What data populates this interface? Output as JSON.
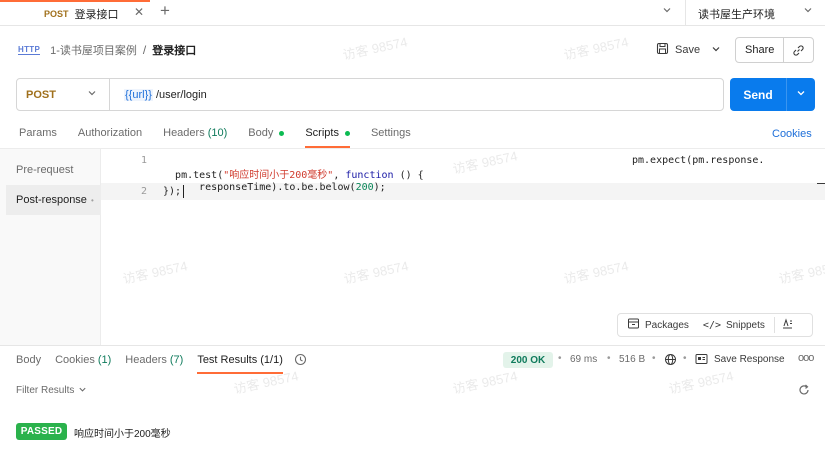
{
  "tab": {
    "method": "POST",
    "title": "登录接口",
    "close": "✕",
    "add": "+"
  },
  "environment": {
    "name": "读书屋生产环境"
  },
  "breadcrumb": {
    "protocol_icon_text": "HTTP",
    "collection": "1-读书屋项目案例",
    "separator": "/",
    "request": "登录接口"
  },
  "actions": {
    "save_label": "Save",
    "share_label": "Share"
  },
  "request": {
    "method": "POST",
    "url_variable": "{{url}}",
    "url_path": " /user/login",
    "send_label": "Send"
  },
  "request_tabs": [
    {
      "label": "Params"
    },
    {
      "label": "Authorization"
    },
    {
      "label": "Headers",
      "count": "(10)"
    },
    {
      "label": "Body",
      "dot": true
    },
    {
      "label": "Scripts",
      "dot": true,
      "active": true
    },
    {
      "label": "Settings"
    }
  ],
  "cookies_link": "Cookies",
  "scripts_side": {
    "pre_request": "Pre-request",
    "post_response": "Post-response",
    "post_response_dot": "•"
  },
  "editor": {
    "line_numbers": [
      "1",
      "2"
    ],
    "line1_a": "pm.test(",
    "line1_str": "\"响应时间小于200毫秒\"",
    "line1_b": ", ",
    "line1_kw": "function",
    "line1_c": " () {",
    "line1_right": "pm.expect(pm.response.",
    "line1_wrap_a": "responseTime).to.be.below(",
    "line1_wrap_num": "200",
    "line1_wrap_b": ");",
    "line2": "});"
  },
  "editor_tools": {
    "packages": "Packages",
    "snippets_glyph": "</>",
    "snippets": "Snippets"
  },
  "response_tabs": [
    {
      "label": "Body"
    },
    {
      "label": "Cookies",
      "count": "(1)"
    },
    {
      "label": "Headers",
      "count": "(7)"
    },
    {
      "label": "Test Results",
      "count": "(1/1)",
      "active": true
    }
  ],
  "response_meta": {
    "status": "200 OK",
    "time": "69 ms",
    "size": "516 B",
    "save_response": "Save Response",
    "more": "ooo"
  },
  "filter": {
    "label": "Filter Results",
    "chevron": "⌄"
  },
  "test_results": [
    {
      "status": "PASSED",
      "name": "响应时间小于200毫秒"
    }
  ],
  "watermark": "访客 98574",
  "colors": {
    "accent_orange": "#ff6c37",
    "send_blue": "#097bed",
    "pass_green": "#2bb24c",
    "status_green": "#0f7b5c",
    "method_post": "#a0701c"
  }
}
